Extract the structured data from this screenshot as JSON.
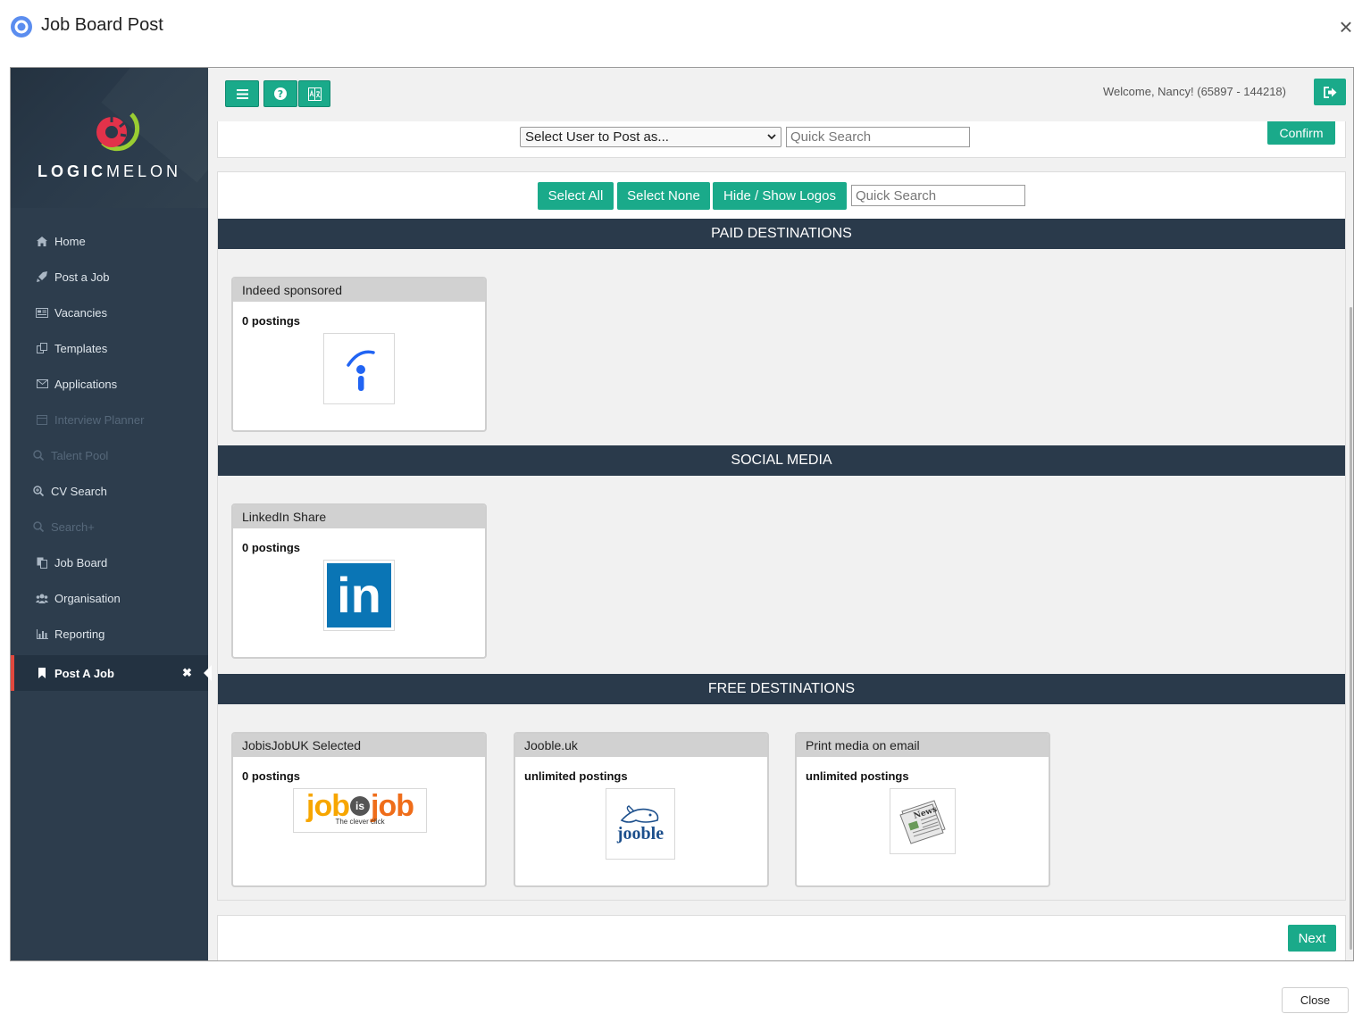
{
  "dialog": {
    "title": "Job Board Post",
    "close_button": "Close"
  },
  "brand": {
    "word_bold": "LOGIC",
    "word_light": "MELON"
  },
  "sidebar": {
    "items": [
      {
        "label": "Home",
        "icon": "home-icon"
      },
      {
        "label": "Post a Job",
        "icon": "rocket-icon"
      },
      {
        "label": "Vacancies",
        "icon": "newspaper-icon"
      },
      {
        "label": "Templates",
        "icon": "copy-icon"
      },
      {
        "label": "Applications",
        "icon": "envelope-icon"
      },
      {
        "label": "Interview Planner",
        "icon": "calendar-icon",
        "disabled": true
      },
      {
        "label": "Talent Pool",
        "icon": "search-icon",
        "disabled": true
      },
      {
        "label": "CV Search",
        "icon": "search-plus-icon"
      },
      {
        "label": "Search+",
        "icon": "search-icon",
        "disabled": true
      },
      {
        "label": "Job Board",
        "icon": "file-copy-icon"
      },
      {
        "label": "Organisation",
        "icon": "users-icon"
      },
      {
        "label": "Reporting",
        "icon": "bar-chart-icon"
      }
    ],
    "active_tab": {
      "label": "Post A Job",
      "icon": "bookmark-icon",
      "close": "✖"
    }
  },
  "topbar": {
    "welcome": "Welcome, Nancy! (65897 - 144218)"
  },
  "post_as": {
    "select_value": "Select User to Post as...",
    "search_placeholder": "Quick Search",
    "confirm": "Confirm"
  },
  "destinations": {
    "select_all": "Select All",
    "select_none": "Select None",
    "hide_show_logos": "Hide / Show Logos",
    "search_placeholder": "Quick Search",
    "sections": [
      {
        "title": "PAID DESTINATIONS",
        "cards": [
          {
            "name": "Indeed sponsored",
            "postings": "0 postings"
          }
        ]
      },
      {
        "title": "SOCIAL MEDIA",
        "cards": [
          {
            "name": "LinkedIn Share",
            "postings": "0 postings"
          }
        ]
      },
      {
        "title": "FREE DESTINATIONS",
        "cards": [
          {
            "name": "JobisJobUK Selected",
            "postings": "0 postings"
          },
          {
            "name": "Jooble.uk",
            "postings": "unlimited postings"
          },
          {
            "name": "Print media on email",
            "postings": "unlimited postings"
          }
        ]
      }
    ]
  },
  "logos": {
    "jobisjob_left": "job",
    "jobisjob_mid": "is",
    "jobisjob_right": "job",
    "jobisjob_tagline": "The clever click",
    "jooble": "jooble",
    "linkedin": "in",
    "news": "News"
  },
  "footer": {
    "next": "Next"
  },
  "colors": {
    "accent": "#1aaa8a",
    "sidebar": "#2d3d4d",
    "section_bar": "#2a3a4b",
    "active_marker": "#e0483e"
  }
}
